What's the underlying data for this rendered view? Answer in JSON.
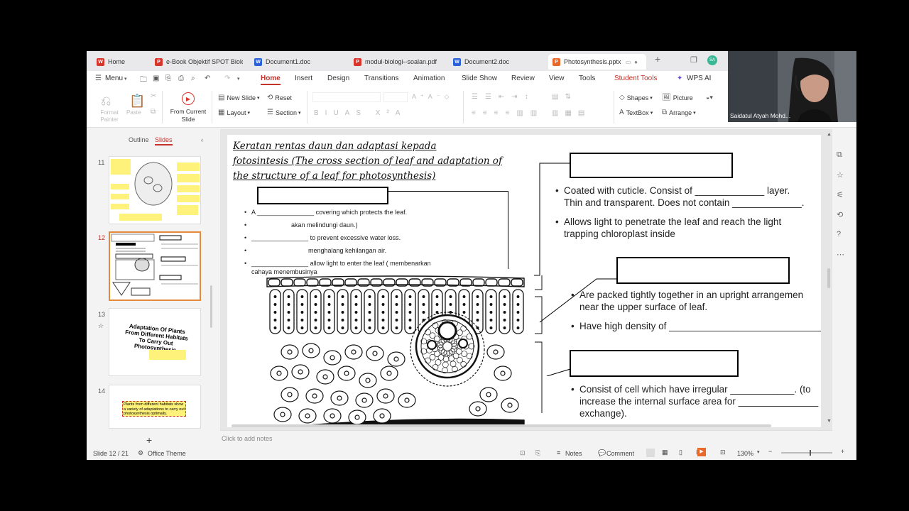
{
  "tabs": [
    {
      "label": "Home",
      "icon": "wps-icon",
      "color": "#d9362b"
    },
    {
      "label": "e-Book Objektif SPOT Biolog",
      "icon": "pdf-icon",
      "color": "#d9362b"
    },
    {
      "label": "Document1.doc",
      "icon": "word-icon",
      "color": "#2b62d9"
    },
    {
      "label": "modul-biologi--soalan.pdf",
      "icon": "pdf-icon",
      "color": "#d9362b"
    },
    {
      "label": "Document2.doc",
      "icon": "word-icon",
      "color": "#2b62d9"
    },
    {
      "label": "Photosynthesis.pptx",
      "icon": "pptx-icon",
      "color": "#e8692a"
    }
  ],
  "avatar_initials": "SA",
  "menu": {
    "menu_label": "Menu",
    "items": [
      "Home",
      "Insert",
      "Design",
      "Transitions",
      "Animation",
      "Slide Show",
      "Review",
      "View",
      "Tools",
      "Student Tools",
      "WPS AI"
    ]
  },
  "ribbon": {
    "format_painter": "Format Painter",
    "paste": "Paste",
    "from_current_slide": "From Current Slide",
    "new_slide": "New Slide",
    "reset": "Reset",
    "layout": "Layout",
    "section": "Section",
    "shapes": "Shapes",
    "picture": "Picture",
    "textbox": "TextBox",
    "arrange": "Arrange"
  },
  "left_panel": {
    "outline_tab": "Outline",
    "slides_tab": "Slides",
    "slide_numbers": [
      "11",
      "12",
      "13",
      "14"
    ],
    "thumb13_title": "Adaptation Of Plants From Different Habitats To Carry Out Photosynthesis",
    "thumb14_text": "Plants from different habitats show a variety of adaptations to carry out photosynthesis optimally."
  },
  "slide": {
    "title_line1": "Keratan rentas daun dan adaptasi kepada",
    "title_line2": "fotosintesis (The cross section of leaf and adaptation of",
    "title_line3": "the structure of a leaf for photosynthesis)",
    "left_items": [
      "A ________________ covering which protects the leaf.",
      "akan melindungi daun.)",
      "________________ to prevent excessive water loss.",
      "menghalang kehilangan air.",
      "________________ allow light to enter the leaf (               membenarkan",
      "cahaya menembusinya"
    ],
    "right_block1": [
      "Coated with cuticle. Consist of _____________ layer.",
      "Thin and transparent. Does not contain _____________.",
      "Allows light to penetrate the leaf and reach the light",
      "trapping chloroplast inside"
    ],
    "right_block2": [
      "Are packed tightly together in an upright arrangemen",
      "near the upper surface of leaf.",
      "Have high density of _______________________________"
    ],
    "right_block3": [
      "Consist of cell which have irregular ____________. (to",
      "increase the internal surface area for _______________",
      "exchange)."
    ]
  },
  "notes_placeholder": "Click to add notes",
  "status": {
    "slide_info": "Slide 12 / 21",
    "theme": "Office Theme",
    "notes": "Notes",
    "comment": "Comment",
    "zoom": "130%"
  },
  "webcam_name": "Saidatul Atyah Mohd..."
}
